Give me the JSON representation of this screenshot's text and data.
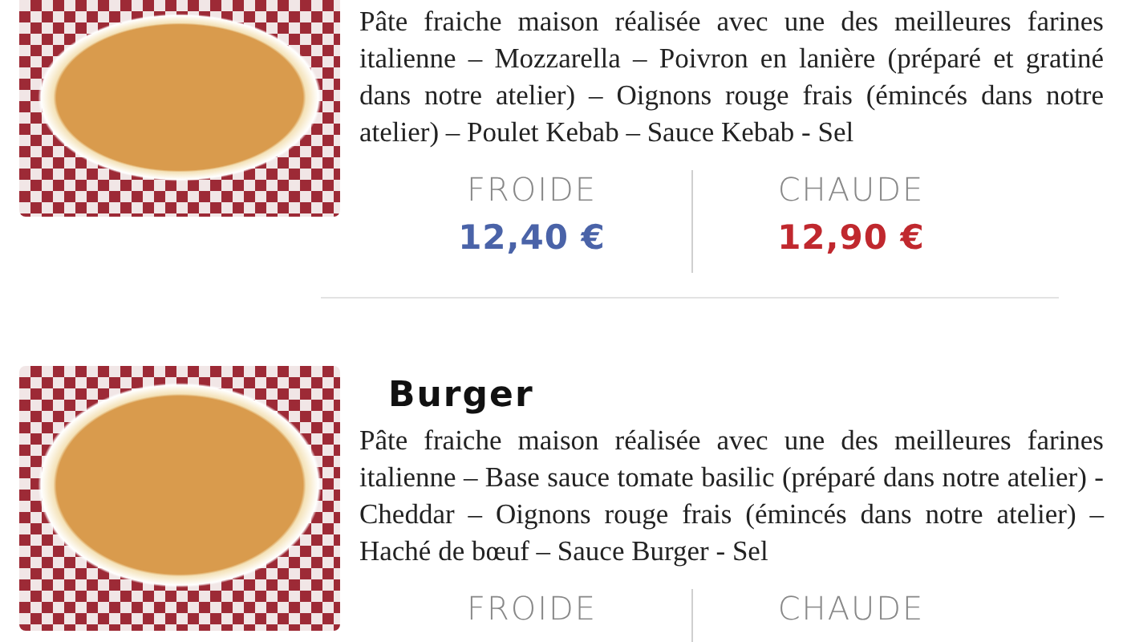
{
  "items": [
    {
      "description": "Pâte fraiche maison réalisée avec une des meilleures farines italienne – Mozzarella – Poivron en lanière (préparé et gratiné dans notre atelier)  – Oignons rouge frais (émincés dans notre atelier) – Poulet Kebab – Sauce Kebab - Sel",
      "prices": [
        {
          "label": "FROIDE",
          "value": "12,40 €",
          "color": "#4a63a8"
        },
        {
          "label": "CHAUDE",
          "value": "12,90 €",
          "color": "#c0282e"
        }
      ]
    },
    {
      "title": "Burger",
      "description": "Pâte fraiche maison réalisée avec une des meilleures farines italienne – Base sauce tomate basilic (préparé dans notre atelier) - Cheddar – Oignons rouge frais (émincés dans notre atelier) – Haché de bœuf – Sauce Burger - Sel",
      "prices": [
        {
          "label": "FROIDE"
        },
        {
          "label": "CHAUDE"
        }
      ]
    }
  ]
}
